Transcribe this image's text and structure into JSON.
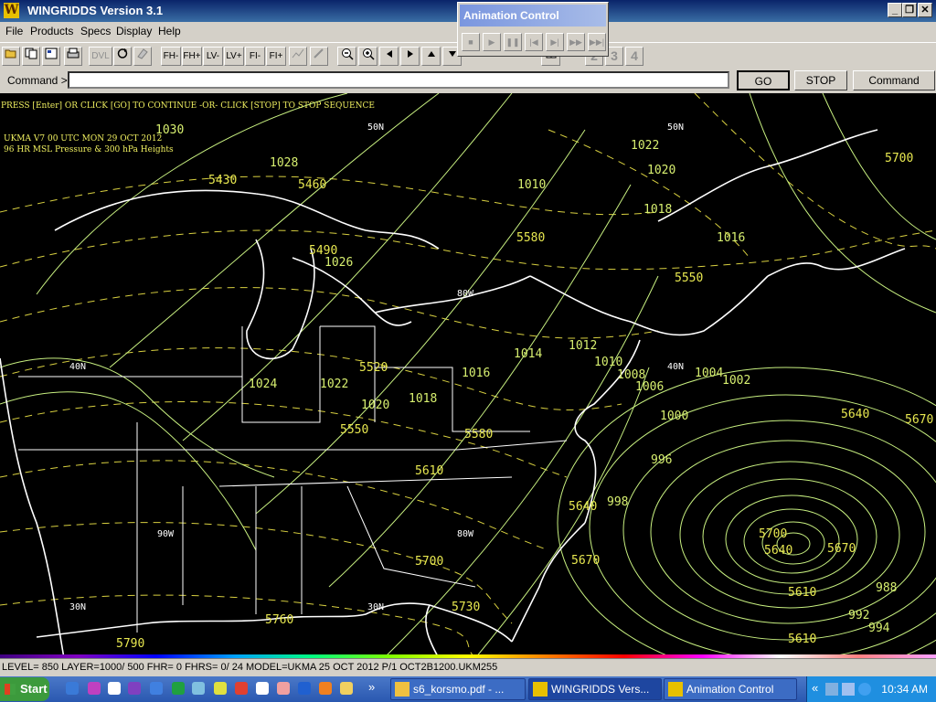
{
  "window": {
    "title": "WINGRIDDS Version 3.1",
    "logo": "W",
    "controls": [
      "_",
      "❐",
      "✕"
    ]
  },
  "menu": [
    "File",
    "Products",
    "Specs",
    "Display",
    "Help"
  ],
  "toolbar": {
    "text_buttons": [
      "DVL",
      "FH-",
      "FH+",
      "LV-",
      "LV+",
      "FI-",
      "FI+"
    ],
    "icons": [
      "open-icon",
      "copy-icon",
      "properties-icon",
      "print-icon",
      "refresh-icon",
      "eraser-icon",
      "chart-icon",
      "pen-icon",
      "zoom-out-icon",
      "zoom-in-icon",
      "left-arrow-icon",
      "right-arrow-icon",
      "up-arrow-icon",
      "down-arrow-icon",
      "grid-icon"
    ],
    "numbers": [
      "2",
      "3",
      "4"
    ]
  },
  "command": {
    "label": "Command >",
    "value": "",
    "go": "GO",
    "stop": "STOP",
    "history": "Command History"
  },
  "animation": {
    "title": "Animation Control",
    "buttons": [
      "stop-icon",
      "play-icon",
      "pause-icon",
      "first-frame-icon",
      "next-frame-icon",
      "fast-forward-icon",
      "last-frame-icon"
    ]
  },
  "map": {
    "header": [
      "PRESS [Enter] OR CLICK [GO] TO CONTINUE -OR- CLICK [STOP] TO STOP SEQUENCE",
      "UKMA    V7 00 UTC MON 29 OCT 2012",
      "96 HR MSL Pressure & 300 hPa Heights"
    ],
    "lat_labels": [
      "50N",
      "50N",
      "40N",
      "40N",
      "30N",
      "30N",
      "80W",
      "80W",
      "90W"
    ],
    "pressure_labels": [
      "1030",
      "1026",
      "1024",
      "1022",
      "1020",
      "1018",
      "1016",
      "1014",
      "1012",
      "1010",
      "1008",
      "1006",
      "1004",
      "1002",
      "1000",
      "998",
      "996",
      "988",
      "992",
      "994",
      "1020",
      "1022",
      "1016",
      "1018",
      "1010",
      "1028",
      "1026",
      "1030"
    ],
    "height_labels": [
      "5430",
      "5460",
      "5490",
      "5550",
      "5580",
      "5610",
      "5640",
      "5670",
      "5700",
      "5730",
      "5760",
      "5790",
      "5700",
      "5640",
      "5670",
      "5610",
      "5580",
      "5550",
      "5520",
      "5610",
      "5640",
      "5670",
      "5700"
    ]
  },
  "status": "LEVEL= 850 LAYER=1000/ 500 FHR=  0 FHRS=  0/ 24 MODEL=UKMA  25 OCT 2012 P/1 OCT2B1200.UKM255",
  "taskbar": {
    "start": "Start",
    "more": "»",
    "tasks": [
      "s6_korsmo.pdf - ...",
      "WINGRIDDS Vers...",
      "Animation Control"
    ],
    "tray_more": "«",
    "clock": "10:34 AM"
  },
  "colors": {
    "title_bar": "#0a246a",
    "map_bg": "#000000",
    "label_yellow": "#e8e850",
    "isobar_green": "#c8f080",
    "coast_white": "#ffffff"
  }
}
